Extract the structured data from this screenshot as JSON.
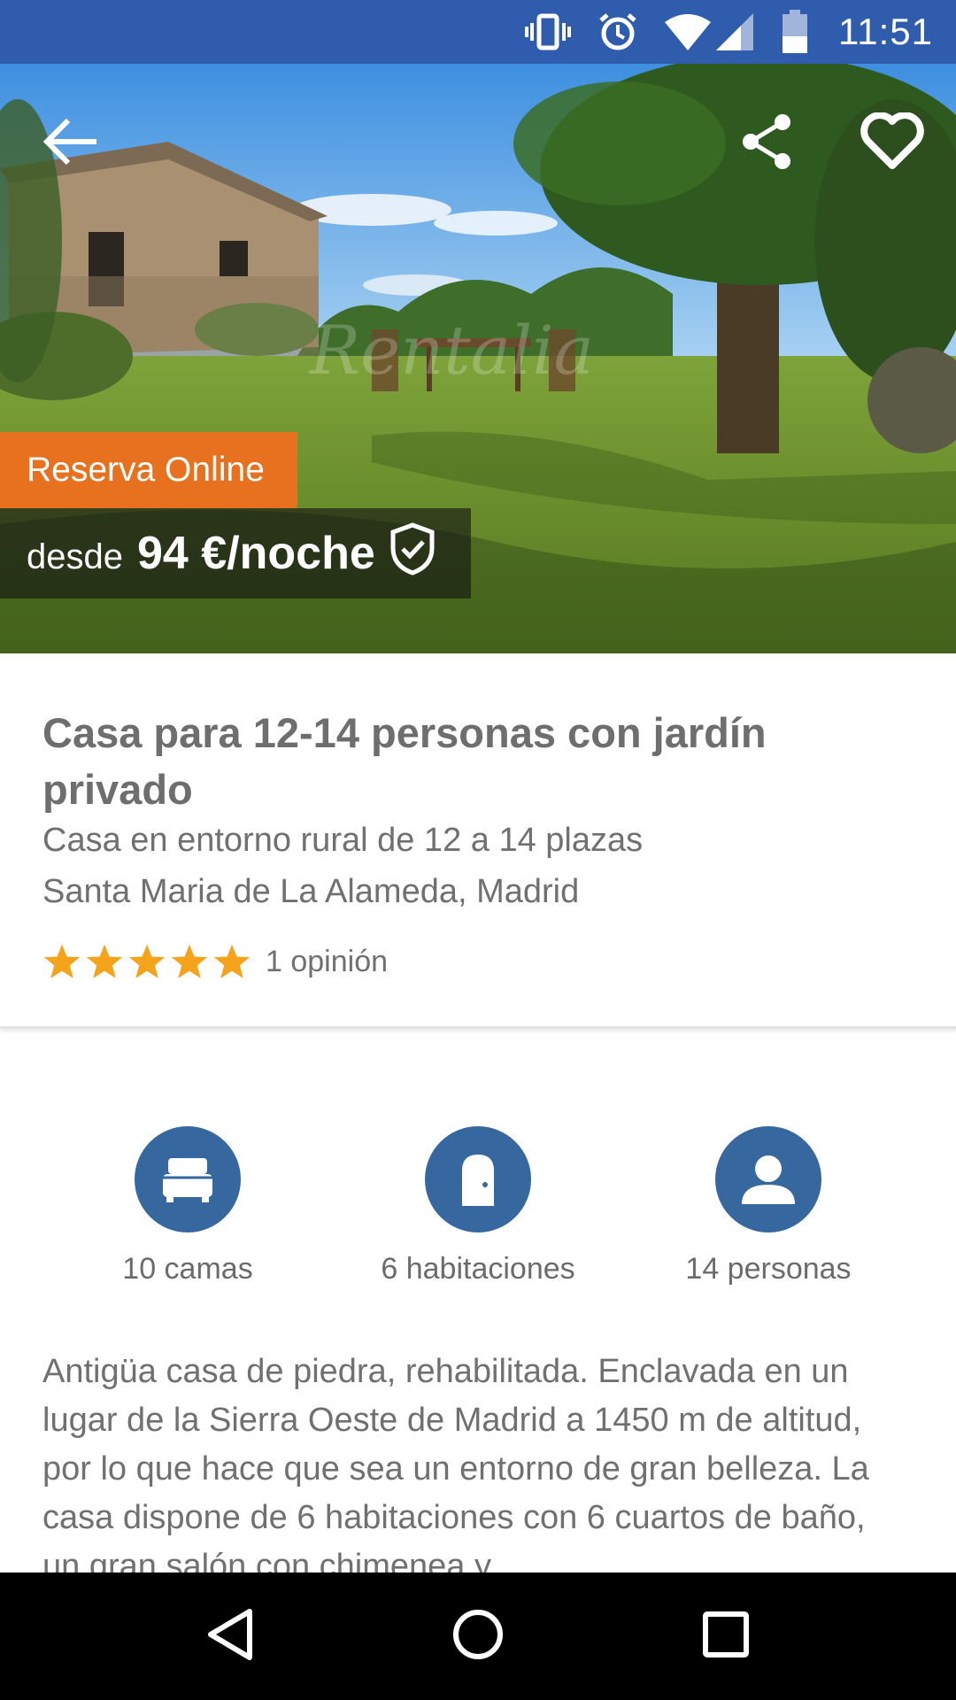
{
  "status_bar": {
    "time": "11:51",
    "icons": [
      "vibrate-icon",
      "alarm-icon",
      "wifi-icon",
      "signal-icon",
      "battery-icon"
    ],
    "background_color": "#2f5cad"
  },
  "hero": {
    "icons": {
      "back": "back-arrow-icon",
      "share": "share-icon",
      "favorite": "heart-icon"
    },
    "badge_label": "Reserva Online",
    "badge_color": "#e8711f",
    "price_prefix": "desde",
    "price": "94 €/noche",
    "watermark": "Rentalia"
  },
  "listing": {
    "title": "Casa para 12-14 personas con jardín privado",
    "subtitle": "Casa en entorno rural de 12 a 14 plazas",
    "location": "Santa Maria de La Alameda, Madrid",
    "rating_stars": 5,
    "rating_max": 5,
    "opinions": "1 opinión",
    "star_color": "#f5a31a"
  },
  "features": [
    {
      "icon": "bed-icon",
      "label": "10 camas"
    },
    {
      "icon": "door-icon",
      "label": "6 habitaciones"
    },
    {
      "icon": "person-icon",
      "label": "14 personas"
    }
  ],
  "feature_color": "#36679f",
  "description": "Antigüa casa de piedra, rehabilitada. Enclavada en un lugar de la Sierra Oeste de Madrid a 1450 m de altitud, por lo que hace que sea un entorno de gran belleza. La casa dispone de 6 habitaciones con 6 cuartos de baño, un gran salón con chimenea y",
  "nav_bar": {
    "icons": [
      "nav-back-icon",
      "nav-home-icon",
      "nav-recents-icon"
    ]
  }
}
